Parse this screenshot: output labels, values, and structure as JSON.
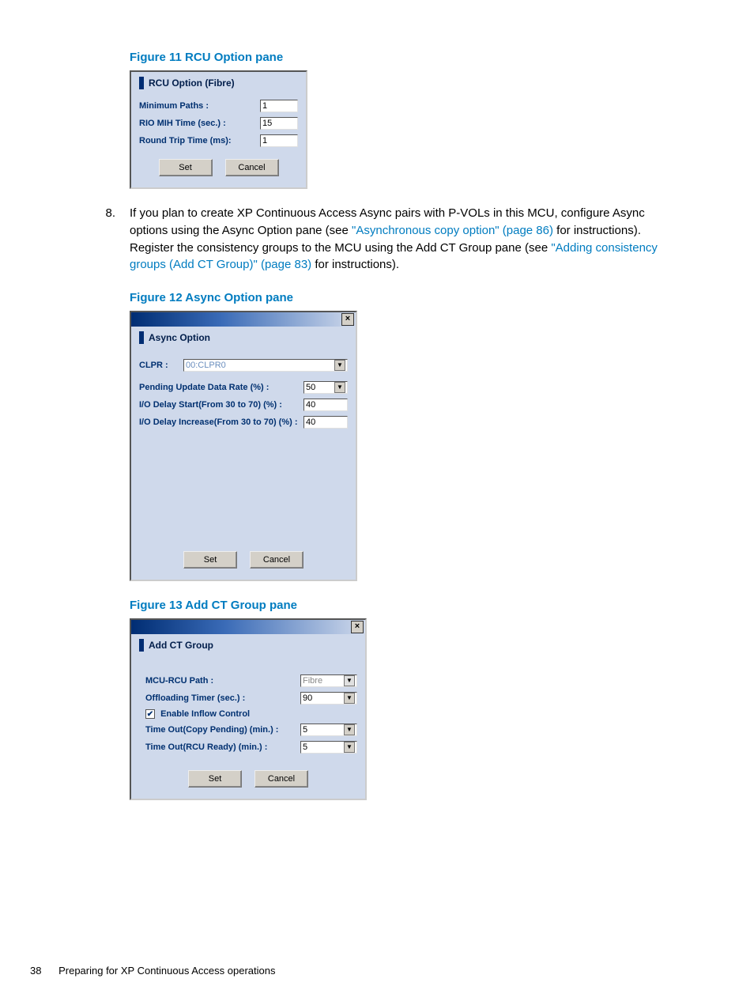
{
  "fig11": {
    "caption": "Figure 11 RCU Option pane",
    "title": "RCU Option (Fibre)",
    "rows": {
      "minpaths": {
        "label": "Minimum Paths :",
        "value": "1"
      },
      "riomih": {
        "label": "RIO MIH Time (sec.) :",
        "value": "15"
      },
      "rtt": {
        "label": "Round Trip Time (ms):",
        "value": "1"
      }
    },
    "set": "Set",
    "cancel": "Cancel"
  },
  "step8": {
    "num": "8.",
    "t1": "If you plan to create XP Continuous Access Async pairs with P-VOLs in this MCU, configure Async options using the Async Option pane (see ",
    "link1": "\"Asynchronous copy option\" (page 86)",
    "t2": " for instructions). Register the consistency groups to the MCU using the Add CT Group pane (see ",
    "link2": "\"Adding consistency groups (Add CT Group)\" (page 83)",
    "t3": " for instructions)."
  },
  "fig12": {
    "caption": "Figure 12 Async Option pane",
    "title": "Async Option",
    "rows": {
      "clpr": {
        "label": "CLPR  :",
        "value": "00:CLPR0"
      },
      "pending": {
        "label": "Pending Update Data Rate (%) :",
        "value": "50"
      },
      "delaystart": {
        "label": "I/O Delay Start(From 30 to 70) (%) :",
        "value": "40"
      },
      "delayinc": {
        "label": "I/O Delay Increase(From 30 to 70) (%) :",
        "value": "40"
      }
    },
    "set": "Set",
    "cancel": "Cancel"
  },
  "fig13": {
    "caption": "Figure 13 Add CT Group pane",
    "title": "Add CT Group",
    "rows": {
      "path": {
        "label": "MCU-RCU Path :",
        "value": "Fibre"
      },
      "offload": {
        "label": "Offloading Timer (sec.) :",
        "value": "90"
      },
      "inflow": {
        "label": "Enable Inflow Control"
      },
      "topend": {
        "label": "Time Out(Copy Pending) (min.) :",
        "value": "5"
      },
      "torcu": {
        "label": "Time Out(RCU Ready) (min.) :",
        "value": "5"
      }
    },
    "set": "Set",
    "cancel": "Cancel"
  },
  "footer": {
    "page": "38",
    "title": "Preparing for XP Continuous Access operations"
  }
}
